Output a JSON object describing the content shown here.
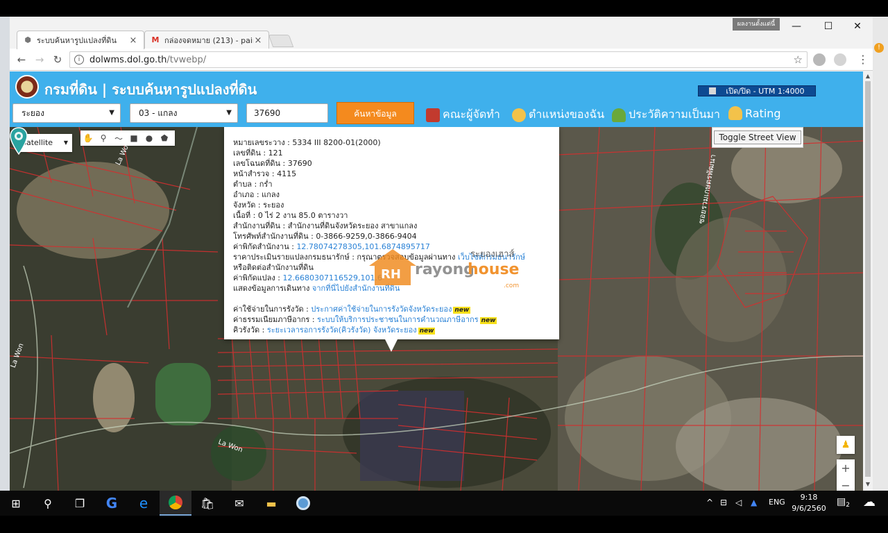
{
  "browser": {
    "tabs": [
      {
        "label": "ระบบค้นหารูปแปลงที่ดิน",
        "icon": "cube-icon",
        "close": "×"
      },
      {
        "label": "กล่องจดหมาย (213) - paira",
        "icon": "gmail-icon",
        "close": "×"
      }
    ],
    "profile_label": "ผลงานตั้งแต่นี้",
    "url_host": "dolwms.dol.go.th",
    "url_path": "/tvwebp/",
    "window_controls": [
      "—",
      "☐",
      "✕"
    ]
  },
  "header": {
    "title": "กรมที่ดิน | ระบบค้นหารูปแปลงที่ดิน",
    "utm_toggle": "เปิด/ปิด - UTM 1:4000"
  },
  "search": {
    "province": "ระยอง",
    "district": "03 - แกลง",
    "parcel_number": "37690",
    "search_button": "ค้นหาข้อมูล"
  },
  "nav": {
    "developers": "คณะผู้จัดทำ",
    "my_location": "ตำแหน่งของฉัน",
    "history": "ประวัติความเป็นมา",
    "rating": "Rating"
  },
  "map": {
    "map_type": "Satellite",
    "street_view": "Toggle Street View",
    "labels": [
      "La Won",
      "La Won",
      "La Won"
    ],
    "road_label": "ซอยรวมเกษตรพัฒนา"
  },
  "popup": {
    "rows": [
      {
        "label": "หมายเลขระวาง",
        "value": "5334 III 8200-01(2000)"
      },
      {
        "label": "เลขที่ดิน",
        "value": "121"
      },
      {
        "label": "เลขโฉนดที่ดิน",
        "value": "37690"
      },
      {
        "label": "หน้าสำรวจ",
        "value": "4115"
      },
      {
        "label": "ตำบล",
        "value": "กร่ำ"
      },
      {
        "label": "อำเภอ",
        "value": "แกลง"
      },
      {
        "label": "จังหวัด",
        "value": "ระยอง"
      },
      {
        "label": "เนื้อที่",
        "value": "0 ไร่ 2 งาน 85.0 ตารางวา"
      },
      {
        "label": "สำนักงานที่ดิน",
        "value": "สำนักงานที่ดินจังหวัดระยอง สาขาแกลง"
      },
      {
        "label": "โทรศัพท์สำนักงานที่ดิน",
        "value": "0-3866-9259,0-3866-9404"
      }
    ],
    "office_coord_label": "ค่าพิกัดสำนักงาน",
    "office_coord": "12.78074278305,101.6874895717",
    "appraisal_label": "ราคาประเมินรายแปลงกรมธนารักษ์",
    "appraisal_text": "กรุณาตรวจสอบข้อมูลผ่านทาง",
    "appraisal_link": "เว็บไซต์กรมธนารักษ์",
    "appraisal_text2": "หรือติดต่อสำนักงานที่ดิน",
    "parcel_coord_label": "ค่าพิกัดแปลง",
    "parcel_coord": "12.6680307116529,101.6",
    "route_label": "แสดงข้อมูลการเดินทาง",
    "route_link": "จากที่นี่ไปยังสำนักงานที่ดิน",
    "fee_label": "ค่าใช้จ่ายในการรังวัด",
    "fee_link": "ประกาศค่าใช้จ่ายในการรังวัดจังหวัดระยอง",
    "tax_label": "ค่าธรรมเนียมภาษีอากร",
    "tax_link": "ระบบให้บริการประชาชนในการคำนวณภาษีอากร",
    "queue_label": "คิวรังวัด",
    "queue_link": "ระยะเวลารอการรังวัด(คิวรังวัด) จังหวัดระยอง",
    "new_badge": "new"
  },
  "watermark": {
    "thai": "ระยองเฮาส์",
    "rayong": "rayong",
    "house": "house",
    "com": ".com",
    "logo_text": "RH"
  },
  "taskbar": {
    "lang": "ENG",
    "time": "9:18",
    "date": "9/6/2560",
    "notifications": "2"
  }
}
